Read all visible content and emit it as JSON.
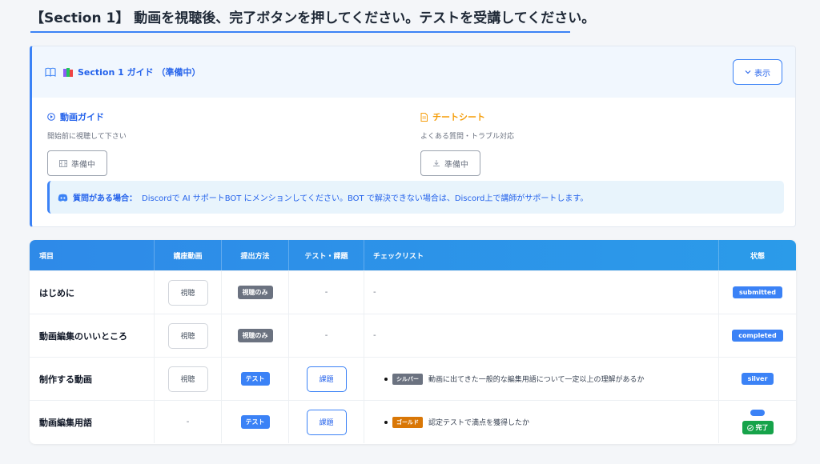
{
  "page": {
    "title": "【Section 1】 動画を視聴後、完了ボタンを押してください。テストを受講してください。"
  },
  "guide": {
    "title": "Section 1 ガイド （準備中）",
    "show_label": "表示",
    "video": {
      "title": "動画ガイド",
      "subtitle": "開始前に視聴して下さい",
      "button_label": "準備中"
    },
    "cheat": {
      "title": "チートシート",
      "subtitle": "よくある質問・トラブル対応",
      "button_label": "準備中"
    },
    "support": {
      "label": "質問がある場合：",
      "text": "Discordで AI サポートBOT にメンションしてください。BOT で解決できない場合は、Discord上で講師がサポートします。"
    }
  },
  "table": {
    "headers": [
      "項目",
      "講座動画",
      "提出方法",
      "テスト・課題",
      "チェックリスト",
      "状態"
    ],
    "rows": [
      {
        "item": "はじめに",
        "video": "視聴",
        "method": "視聴のみ",
        "test": "-",
        "checklist": "-",
        "status": "submitted"
      },
      {
        "item": "動画編集のいいところ",
        "video": "視聴",
        "method": "視聴のみ",
        "test": "-",
        "checklist": "-",
        "status": "completed"
      },
      {
        "item": "制作する動画",
        "video": "視聴",
        "method": "テスト",
        "test": "課題",
        "checklist_level": "シルバー",
        "checklist": "動画に出てきた一般的な編集用語について一定以上の理解があるか",
        "status": "silver"
      },
      {
        "item": "動画編集用語",
        "video": "-",
        "method": "テスト",
        "test": "課題",
        "checklist_level": "ゴールド",
        "checklist": "認定テストで満点を獲得したか",
        "status": "完了"
      }
    ]
  },
  "colors": {
    "accent": "#3b82f6",
    "success": "#16a34a",
    "gold": "#d97706",
    "cheat": "#f59e0b"
  },
  "icons": [
    "book-icon",
    "books-icon",
    "chevron-down-icon",
    "play-circle-icon",
    "document-icon",
    "film-icon",
    "download-icon",
    "discord-icon",
    "check-circle-icon"
  ]
}
